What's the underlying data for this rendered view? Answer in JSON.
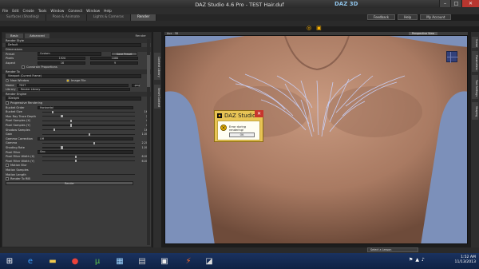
{
  "window": {
    "title": "DAZ Studio 4.6 Pro - TEST Hair.duf",
    "logo": "DAZ 3D"
  },
  "menu": [
    "File",
    "Edit",
    "Create",
    "Tools",
    "Window",
    "Connect",
    "Window",
    "Help"
  ],
  "top_buttons": [
    "Feedback",
    "Help",
    "My Account"
  ],
  "tabs": [
    {
      "label": "Surfaces (Shading)",
      "active": false
    },
    {
      "label": "Pose & Animate",
      "active": false
    },
    {
      "label": "Lights & Cameras",
      "active": false
    },
    {
      "label": "Render",
      "active": true
    }
  ],
  "left_panel": {
    "pane_tabs": [
      "Basic",
      "Advanced"
    ],
    "pane_right_label": "Render",
    "render_style_label": "Render Style",
    "render_style": "Default",
    "dimensions_label": "Dimensions",
    "preset_label": "Preset",
    "preset_value": "Custom",
    "save_preset": "Save Preset",
    "pixels_label": "Pixels",
    "pixels_w": "1920",
    "pixels_h": "1080",
    "aspect_label": "Aspect",
    "aspect_w": "16",
    "aspect_h": "9",
    "constrain": "Constrain Proportions",
    "render_to_label": "Render To",
    "render_to": "Viewport (Current Frame)",
    "new_window": "New Window",
    "image_file": "Image File",
    "name_label": "Name",
    "name_value": "TEST",
    "ext_value": ".png",
    "library_label": "Library",
    "library_value": "Render Library",
    "render_engine_label": "Render Engine",
    "render_engine": "3Delight",
    "progressive": "Progressive Rendering",
    "bucket_order_label": "Bucket Order",
    "bucket_order": "Horizontal",
    "settings": [
      {
        "label": "Bucket Size",
        "value": "16",
        "level": 0.1
      },
      {
        "label": "Max Ray Trace Depth",
        "value": "2",
        "level": 0.2
      },
      {
        "label": "Pixel Samples (X)",
        "value": "4",
        "level": 0.3
      },
      {
        "label": "Pixel Samples (Y)",
        "value": "4",
        "level": 0.3
      },
      {
        "label": "Shadow Samples",
        "value": "16",
        "level": 0.12
      },
      {
        "label": "Gain",
        "value": "1.00",
        "level": 0.5
      }
    ],
    "gamma_correction_label": "Gamma Correction",
    "gamma_correction": "Off",
    "settings2": [
      {
        "label": "Gamma",
        "value": "2.20",
        "level": 0.55
      },
      {
        "label": "Shading Rate",
        "value": "1.00",
        "level": 0.2
      }
    ],
    "pixel_filter_label": "Pixel Filter",
    "pixel_filter": "Sinc",
    "settings3": [
      {
        "label": "Pixel Filter Width (X)",
        "value": "6.00",
        "level": 0.35
      },
      {
        "label": "Pixel Filter Width (Y)",
        "value": "6.00",
        "level": 0.35
      }
    ],
    "motion_blur": "Motion Blur",
    "motion_samples_label": "Motion Samples",
    "motion_length_label": "Motion Length",
    "render_to_rib": "Render To RIB",
    "render_button": "Render"
  },
  "side_tabs_left": [
    "Content Library",
    "Smart Content"
  ],
  "side_tabs_right": [
    "Scene",
    "Parameters",
    "Tool Settings",
    "Shaping"
  ],
  "viewport": {
    "label": "Aux - 3D",
    "camera": "Perspective View"
  },
  "dialog": {
    "title": "DAZ Studio",
    "message": "Error during rendering!",
    "ok": "OK"
  },
  "lesson_select": "Select a Lesson",
  "taskbar": {
    "time": "1:52 AM",
    "date": "11/13/2013"
  },
  "colors": {
    "accent": "#ffb400",
    "dialog_bg": "#e8c455",
    "close_red": "#c7352c"
  }
}
